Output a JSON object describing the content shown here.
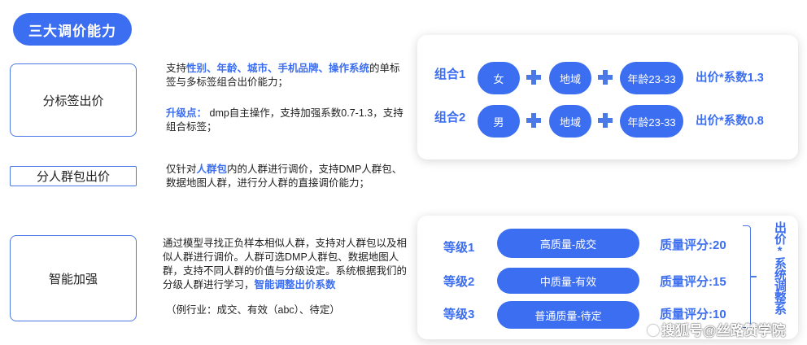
{
  "header": {
    "title": "三大调价能力"
  },
  "capabilities": [
    {
      "label": "分标签出价"
    },
    {
      "label": "分人群包出价"
    },
    {
      "label": "智能加强"
    }
  ],
  "descriptions": {
    "label_bid": {
      "pre": "支持",
      "highlight": "性别、年龄、城市、手机品牌、操作系统",
      "post": "的单标签与多标签组合出价能力；"
    },
    "upgrade": {
      "highlight": "升级点：",
      "text": " dmp自主操作，支持加强系数0.7-1.3，支持组合标签；"
    },
    "crowd_bid": {
      "pre": "仅针对",
      "highlight": "人群包",
      "post": "内的人群进行调价，支持DMP人群包、数据地图人群，进行分人群的直接调价能力；"
    },
    "smart": {
      "pre": "通过模型寻找正负样本相似人群，支持对人群包以及相似人群进行调价。人群可选DMP人群包、数据地图人群，支持不同人群的价值与分级设定。系统根据我们的分级人群进行学习，",
      "highlight": "智能调整出价系数",
      "example": "（例行业：成交、有效（abc）、待定）"
    }
  },
  "combos": [
    {
      "label": "组合1",
      "chips": [
        "女",
        "地域",
        "年龄23-33"
      ],
      "bid": "出价*系数1.3"
    },
    {
      "label": "组合2",
      "chips": [
        "男",
        "地域",
        "年龄23-33"
      ],
      "bid": "出价*系数0.8"
    }
  ],
  "levels": [
    {
      "label": "等级1",
      "chip": "高质量-成交",
      "score": "质量评分:20"
    },
    {
      "label": "等级2",
      "chip": "中质量-有效",
      "score": "质量评分:15"
    },
    {
      "label": "等级3",
      "chip": "普通质量-待定",
      "score": "质量评分:10"
    }
  ],
  "side_label": "出价*系统调整系",
  "watermark": "搜狐号@丝路赞学院",
  "colors": {
    "accent": "#3b6ef0",
    "border": "#4a78e6"
  }
}
